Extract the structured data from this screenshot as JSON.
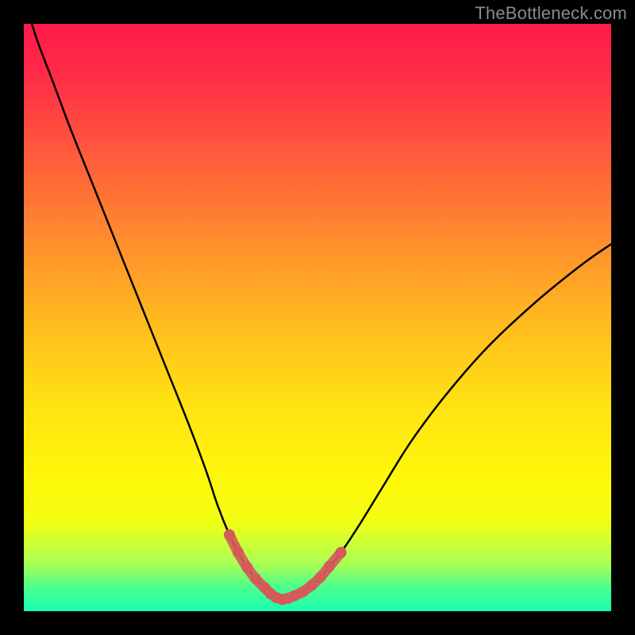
{
  "watermark": "TheBottleneck.com",
  "colors": {
    "curve": "#000000",
    "highlight": "#d55a5a",
    "background_top": "#ff1a4a",
    "background_bottom": "#19ffb0"
  },
  "chart_data": {
    "type": "line",
    "title": "",
    "xlabel": "",
    "ylabel": "",
    "xlim": [
      0,
      100
    ],
    "ylim": [
      0,
      100
    ],
    "grid": false,
    "legend": false,
    "series": [
      {
        "name": "bottleneck-curve-left",
        "x": [
          0,
          2,
          5,
          8,
          12,
          16,
          20,
          24,
          28,
          31,
          33,
          35,
          36.5,
          38,
          39.5,
          41,
          42,
          43,
          44
        ],
        "y": [
          105,
          98,
          90,
          82,
          72,
          62,
          52,
          42,
          32,
          24,
          18,
          13,
          10,
          7.5,
          5.5,
          4,
          3,
          2.3,
          2
        ]
      },
      {
        "name": "bottleneck-curve-right",
        "x": [
          44,
          45,
          46,
          47.5,
          49,
          50.5,
          52,
          54,
          57,
          61,
          66,
          72,
          79,
          87,
          95,
          100
        ],
        "y": [
          2,
          2.2,
          2.6,
          3.3,
          4.4,
          5.8,
          7.6,
          10,
          14.5,
          21,
          29,
          37,
          45,
          52.5,
          59,
          62.5
        ]
      },
      {
        "name": "bottleneck-highlight-left",
        "x": [
          35,
          36.5,
          38,
          39.5,
          41,
          42,
          43,
          44
        ],
        "y": [
          13,
          10,
          7.5,
          5.5,
          4,
          3,
          2.3,
          2
        ]
      },
      {
        "name": "bottleneck-highlight-right",
        "x": [
          44,
          45,
          46,
          47.5,
          49,
          50.5,
          52,
          54
        ],
        "y": [
          2,
          2.2,
          2.6,
          3.3,
          4.4,
          5.8,
          7.6,
          10
        ]
      }
    ],
    "annotations": []
  }
}
